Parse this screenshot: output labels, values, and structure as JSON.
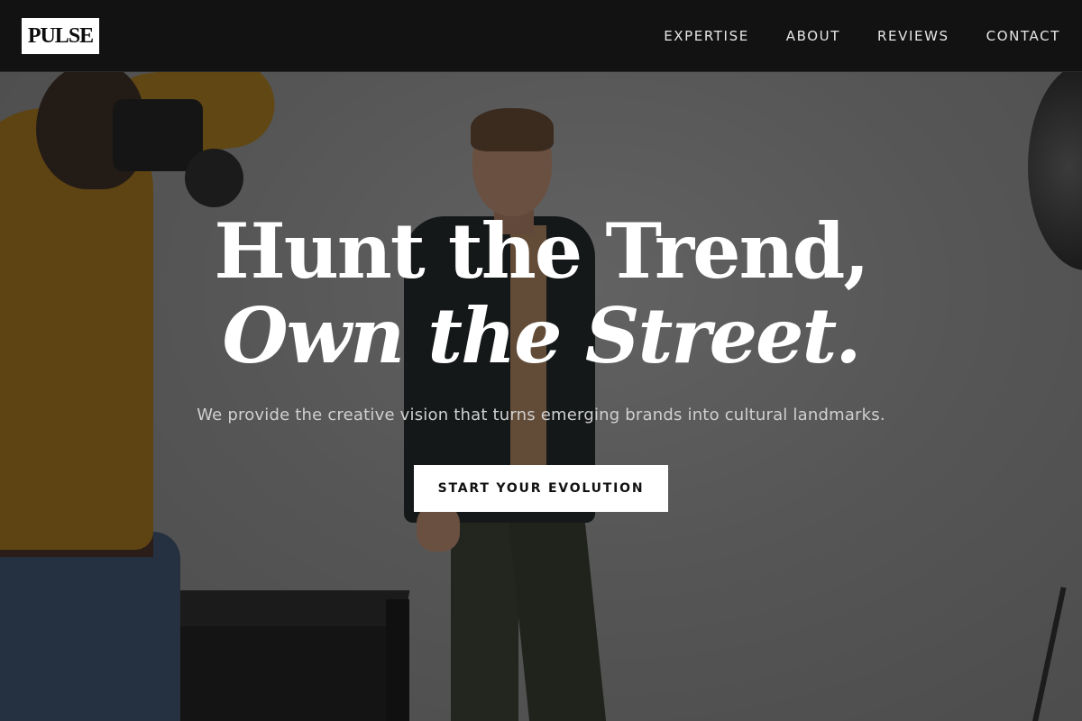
{
  "brand": {
    "logo_text": "PULSE"
  },
  "nav": {
    "items": [
      {
        "label": "EXPERTISE"
      },
      {
        "label": "ABOUT"
      },
      {
        "label": "REVIEWS"
      },
      {
        "label": "CONTACT"
      }
    ]
  },
  "hero": {
    "title_line1": "Hunt the Trend,",
    "title_line2": "Own the Street.",
    "subtitle": "We provide the creative vision that turns emerging brands into cultural landmarks.",
    "cta_label": "START YOUR EVOLUTION",
    "background_image": "photo-shoot-studio"
  },
  "colors": {
    "nav_bg": "#121212",
    "logo_bg": "#ffffff",
    "cta_bg": "#ffffff",
    "text_primary": "#ffffff"
  }
}
